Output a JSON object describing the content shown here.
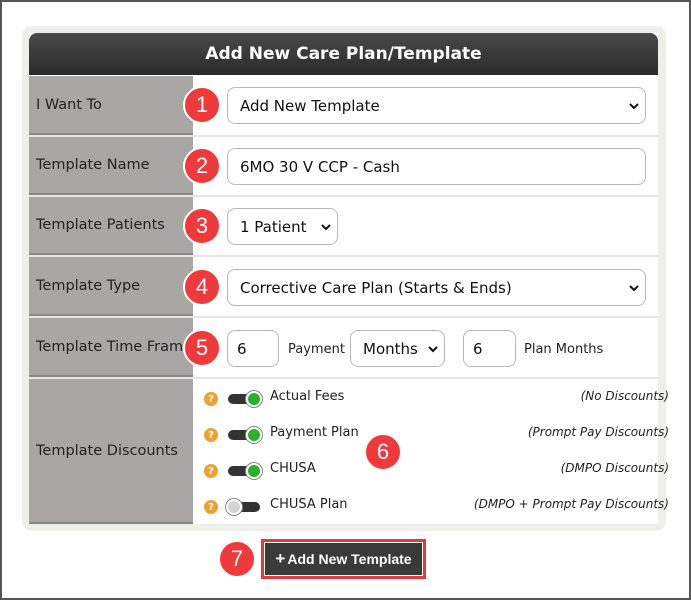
{
  "form": {
    "title": "Add New Care Plan/Template",
    "i_want_to": {
      "label": "I Want To",
      "value": "Add New Template"
    },
    "template_name": {
      "label": "Template Name",
      "value": "6MO 30 V CCP - Cash"
    },
    "template_patients": {
      "label": "Template Patients",
      "value": "1 Patient"
    },
    "template_type": {
      "label": "Template Type",
      "value": "Corrective Care Plan (Starts & Ends)"
    },
    "time_frame": {
      "label": "Template Time Frame",
      "payment_value": "6",
      "payment_label": "Payment",
      "unit_value": "Months",
      "plan_value": "6",
      "plan_label": "Plan Months"
    },
    "discounts": {
      "label": "Template Discounts",
      "items": [
        {
          "name": "Actual Fees",
          "note": "(No Discounts)",
          "on": true
        },
        {
          "name": "Payment Plan",
          "note": "(Prompt Pay Discounts)",
          "on": true
        },
        {
          "name": "CHUSA",
          "note": "(DMPO Discounts)",
          "on": true
        },
        {
          "name": "CHUSA Plan",
          "note": "(DMPO + Prompt Pay Discounts)",
          "on": false
        }
      ]
    },
    "help_glyph": "?",
    "add_button": "Add New Template",
    "add_button_icon": "+"
  },
  "callouts": [
    "1",
    "2",
    "3",
    "4",
    "5",
    "6",
    "7"
  ],
  "colors": {
    "callout": "#ee3a3a",
    "toggle_on": "#2bb02b",
    "help": "#f0a030",
    "header": "#333333"
  }
}
